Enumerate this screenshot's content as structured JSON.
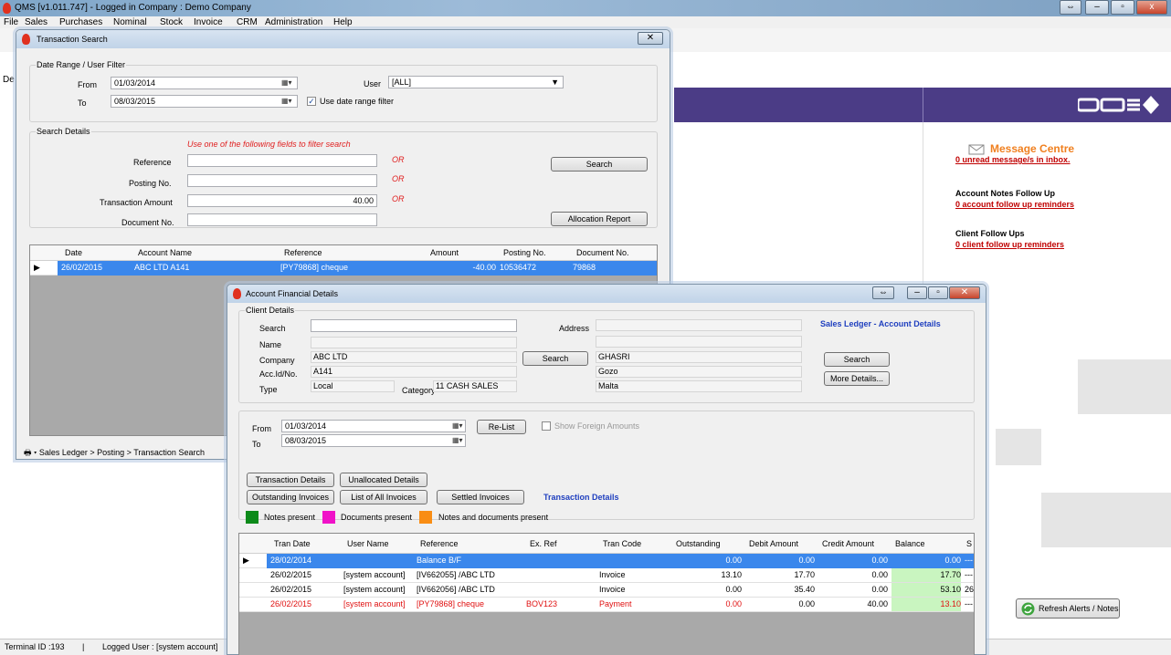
{
  "app": {
    "title": "QMS  [v1.011.747]  -  Logged in Company : Demo Company"
  },
  "menu": [
    "File",
    "Sales",
    "Purchases",
    "Nominal",
    "Stock",
    "Invoice",
    "CRM",
    "Administration",
    "Help"
  ],
  "left_frag": "De",
  "right_pane": {
    "message_centre": {
      "title": "Message Centre",
      "link": "0 unread message/s in inbox."
    },
    "account_notes": {
      "title": "Account Notes Follow Up",
      "link": "0 account follow up reminders"
    },
    "client_followups": {
      "title": "Client Follow Ups",
      "link": "0 client follow up reminders"
    },
    "refresh_btn": "Refresh Alerts / Notes"
  },
  "status": {
    "terminal": "Terminal ID :193",
    "sep": "|",
    "user": "Logged User : [system account]"
  },
  "tsearch": {
    "title": "Transaction Search",
    "date_group": "Date Range / User Filter",
    "from_label": "From",
    "from_value": "01/03/2014",
    "to_label": "To",
    "to_value": "08/03/2015",
    "user_label": "User",
    "user_value": "[ALL]",
    "use_date_label": "Use date range filter",
    "search_group": "Search Details",
    "hint": "Use one of the following fields to filter search",
    "ref_label": "Reference",
    "posting_label": "Posting No.",
    "amount_label": "Transaction Amount",
    "doc_label": "Document No.",
    "amount_value": "40.00",
    "or": "OR",
    "search_btn": "Search",
    "alloc_btn": "Allocation Report",
    "columns": [
      "Date",
      "Account Name",
      "Reference",
      "Amount",
      "Posting No.",
      "Document No."
    ],
    "rows": [
      [
        "26/02/2015",
        "ABC LTD A141",
        "[PY79868] cheque",
        "-40.00",
        "10536472",
        "79868"
      ]
    ],
    "breadcrumb": "Sales Ledger > Posting > Transaction Search"
  },
  "afd": {
    "title": "Account Financial Details",
    "client_group": "Client Details",
    "search_label": "Search",
    "name_label": "Name",
    "company_label": "Company",
    "acc_label": "Acc.Id/No.",
    "type_label": "Type",
    "category_label": "Category",
    "address_label": "Address",
    "company": "ABC LTD",
    "acc": "A141",
    "type": "Local",
    "category": "11 CASH SALES",
    "address": [
      "GHASRI",
      "Gozo",
      "Malta"
    ],
    "sales_ledger_title": "Sales Ledger - Account Details",
    "search_btn": "Search",
    "more_btn": "More Details...",
    "from_label": "From",
    "from_value": "01/03/2014",
    "to_label": "To",
    "to_value": "08/03/2015",
    "relist_btn": "Re-List",
    "foreign_label": "Show Foreign Amounts",
    "tabs": [
      "Transaction Details",
      "Unallocated Details",
      "Outstanding Invoices",
      "List of All Invoices",
      "Settled Invoices"
    ],
    "tab_active": "Transaction Details",
    "legend": [
      "Notes present",
      "Documents present",
      "Notes and documents present"
    ],
    "columns": [
      "Tran Date",
      "User Name",
      "Reference",
      "Ex. Ref",
      "Tran Code",
      "Outstanding",
      "Debit Amount",
      "Credit Amount",
      "Balance",
      "S"
    ],
    "rows": [
      [
        "28/02/2014",
        "",
        "Balance B/F",
        "",
        "",
        "0.00",
        "0.00",
        "0.00",
        "0.00",
        "---"
      ],
      [
        "26/02/2015",
        "[system account]",
        "[IV662055] /ABC LTD",
        "",
        "Invoice",
        "13.10",
        "17.70",
        "0.00",
        "17.70",
        "---"
      ],
      [
        "26/02/2015",
        "[system account]",
        "[IV662056] /ABC LTD",
        "",
        "Invoice",
        "0.00",
        "35.40",
        "0.00",
        "53.10",
        "26"
      ],
      [
        "26/02/2015",
        "[system account]",
        "[PY79868] cheque",
        "BOV123",
        "Payment",
        "0.00",
        "0.00",
        "40.00",
        "13.10",
        "---"
      ]
    ]
  }
}
